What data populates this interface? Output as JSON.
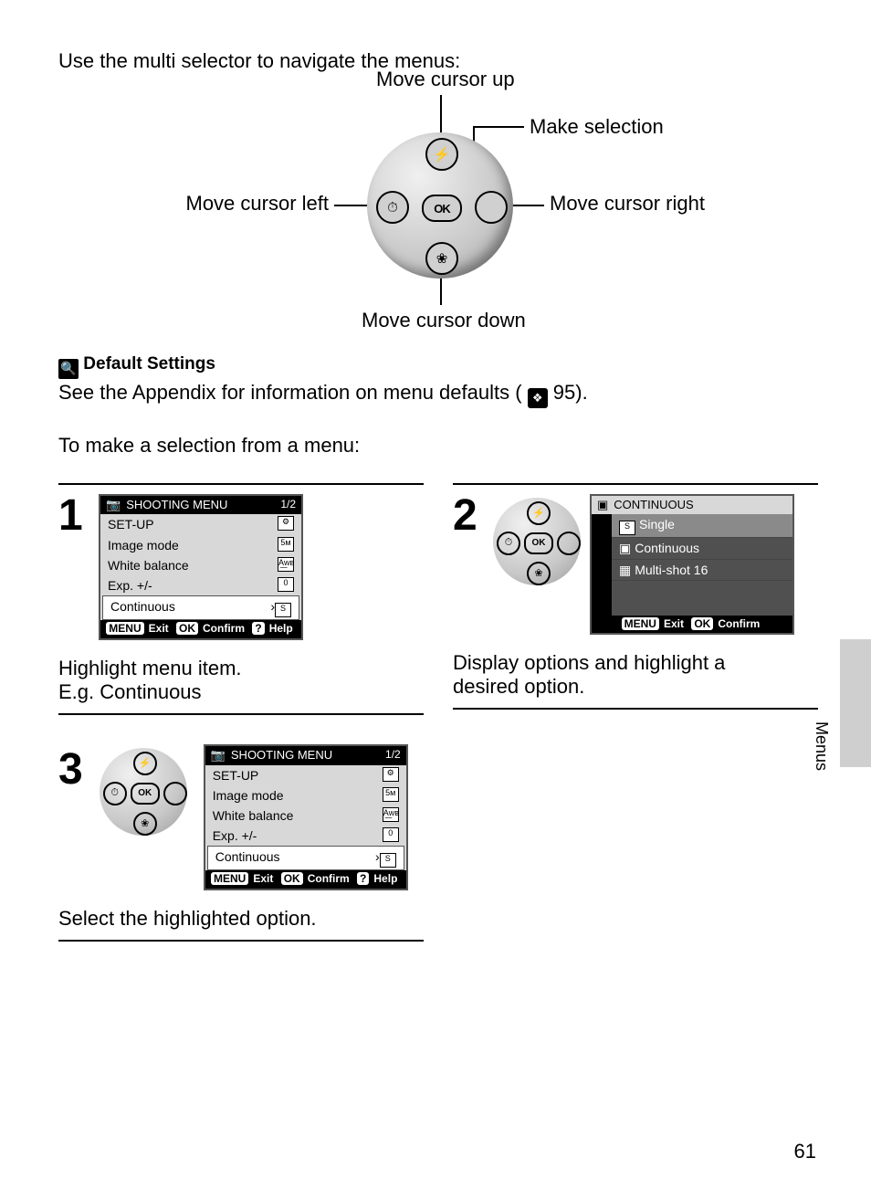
{
  "intro": "Use the multi selector to navigate the menus:",
  "selector": {
    "up": "Move cursor up",
    "down": "Move cursor down",
    "left": "Move cursor left",
    "right": "Move cursor right",
    "select": "Make selection",
    "ok": "OK"
  },
  "tip": {
    "title": "Default Settings",
    "body_pre": "See the Appendix for information on menu defaults (",
    "body_ref": "95",
    "body_post": ")."
  },
  "lead": "To make a selection from a menu:",
  "steps": {
    "1": {
      "num": "1",
      "caption": "Highlight menu item.",
      "sub": "E.g. Continuous"
    },
    "2": {
      "num": "2",
      "caption_l1": "Display options and highlight a",
      "caption_l2": "desired option."
    },
    "3": {
      "num": "3",
      "caption": "Select the highlighted option."
    }
  },
  "lcd_shooting": {
    "title": "SHOOTING MENU",
    "page": "1/2",
    "items": [
      "SET-UP",
      "Image mode",
      "White balance",
      "Exp. +/-",
      "Continuous"
    ],
    "icons": [
      "⚙",
      "5ᴍ",
      "A͟wʙ",
      "0",
      "S"
    ],
    "footer": {
      "menu": "MENU",
      "exit": "Exit",
      "ok": "OK",
      "confirm": "Confirm",
      "q": "?",
      "help": "Help"
    }
  },
  "lcd_continuous": {
    "title": "CONTINUOUS",
    "options": [
      "Single",
      "Continuous",
      "Multi-shot 16"
    ],
    "footer": {
      "menu": "MENU",
      "exit": "Exit",
      "ok": "OK",
      "confirm": "Confirm"
    }
  },
  "side_label": "Menus",
  "page_number": "61"
}
